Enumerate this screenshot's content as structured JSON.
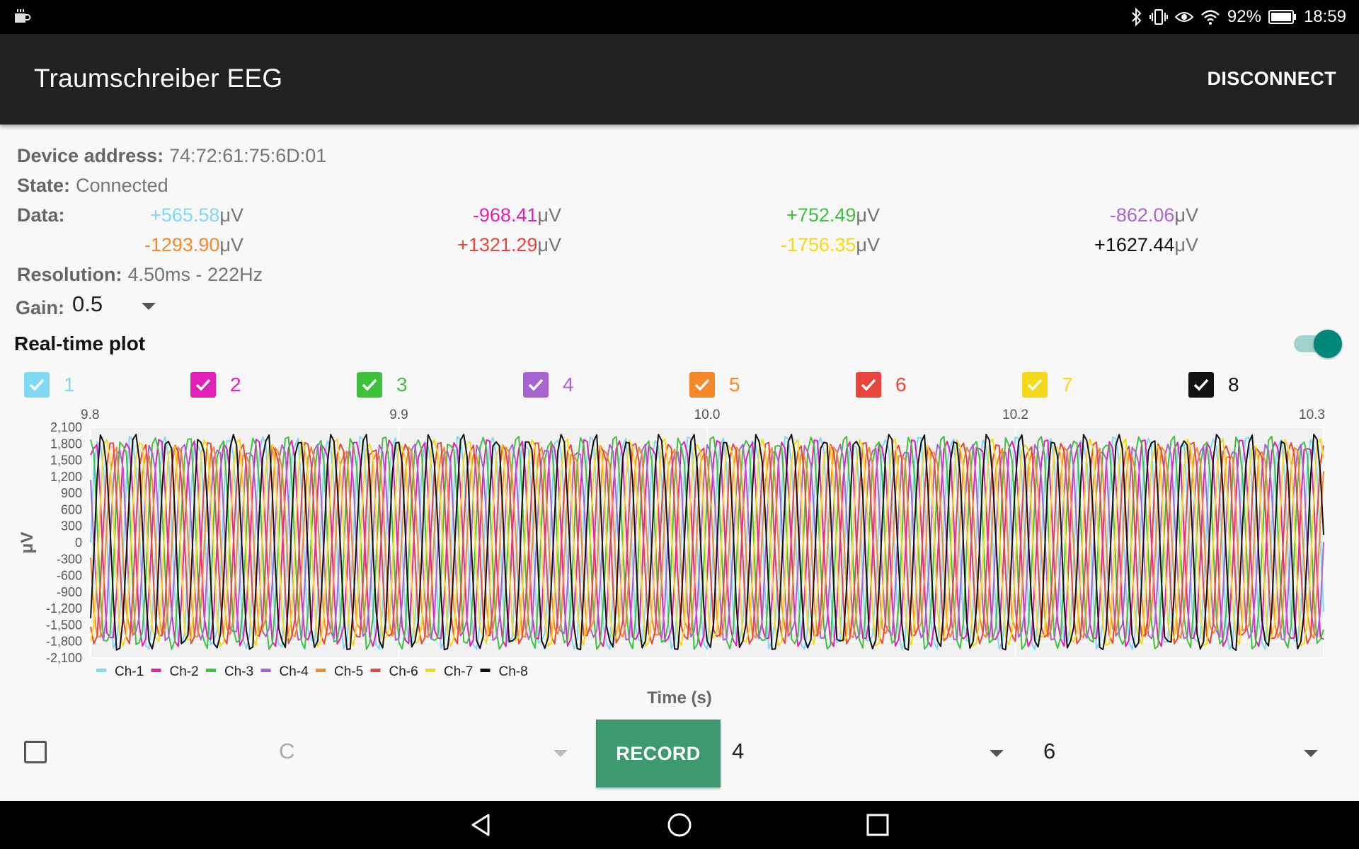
{
  "status_bar": {
    "battery": "92%",
    "time": "18:59",
    "icons": [
      "coffee-icon",
      "bluetooth-icon",
      "vibrate-icon",
      "eye-icon",
      "wifi-icon",
      "battery-icon"
    ]
  },
  "app_bar": {
    "title": "Traumschreiber EEG",
    "action": "DISCONNECT"
  },
  "info": {
    "device_label": "Device address:",
    "device_value": "74:72:61:75:6D:01",
    "state_label": "State:",
    "state_value": "Connected",
    "data_label": "Data:",
    "resolution_label": "Resolution:",
    "resolution_value": "4.50ms - 222Hz",
    "gain_label": "Gain:",
    "gain_value": "0.5"
  },
  "data_unit": "μV",
  "data_values": [
    {
      "value": "+565.58",
      "color": "#7fd8f5"
    },
    {
      "value": "-968.41",
      "color": "#e020b8"
    },
    {
      "value": "+752.49",
      "color": "#3ec23e"
    },
    {
      "value": "-862.06",
      "color": "#a864d2"
    },
    {
      "value": "-1293.90",
      "color": "#f5892a"
    },
    {
      "value": "+1321.29",
      "color": "#e8453c"
    },
    {
      "value": "-1756.35",
      "color": "#f6d81a"
    },
    {
      "value": "+1627.44",
      "color": "#111111"
    }
  ],
  "realtime_plot": {
    "title": "Real-time plot",
    "enabled": true
  },
  "channels": [
    {
      "label": "1",
      "color": "#7fd8f5",
      "checked": true
    },
    {
      "label": "2",
      "color": "#e020b8",
      "checked": true
    },
    {
      "label": "3",
      "color": "#3ec23e",
      "checked": true
    },
    {
      "label": "4",
      "color": "#a864d2",
      "checked": true
    },
    {
      "label": "5",
      "color": "#f5892a",
      "checked": true
    },
    {
      "label": "6",
      "color": "#e8453c",
      "checked": true
    },
    {
      "label": "7",
      "color": "#f6d81a",
      "checked": true
    },
    {
      "label": "8",
      "color": "#111111",
      "checked": true
    }
  ],
  "chart_data": {
    "type": "line",
    "xlabel": "Time (s)",
    "ylabel": "μV",
    "x_ticks": [
      "9.8",
      "9.9",
      "10.0",
      "10.2",
      "10.3"
    ],
    "x_tick_values": [
      9.8,
      9.9,
      10.0,
      10.1,
      10.2
    ],
    "xlim": [
      9.8,
      10.2
    ],
    "ylim": [
      -2100,
      2100
    ],
    "y_ticks": [
      "2,100",
      "1,800",
      "1,500",
      "1,200",
      "900",
      "600",
      "300",
      "0",
      "-300",
      "-600",
      "-900",
      "-1,200",
      "-1,500",
      "-1,800",
      "-2,100"
    ],
    "grid": true,
    "legend_position": "bottom-left",
    "series": [
      {
        "name": "Ch-1",
        "color": "#7fd8f5",
        "amplitude": 1850,
        "cycles_per_second": 100,
        "phase": 0.0
      },
      {
        "name": "Ch-2",
        "color": "#e020b8",
        "amplitude": 1800,
        "cycles_per_second": 100,
        "phase": 0.9
      },
      {
        "name": "Ch-3",
        "color": "#3ec23e",
        "amplitude": 1850,
        "cycles_per_second": 100,
        "phase": 1.7
      },
      {
        "name": "Ch-4",
        "color": "#a864d2",
        "amplitude": 1700,
        "cycles_per_second": 100,
        "phase": 2.5
      },
      {
        "name": "Ch-5",
        "color": "#f5892a",
        "amplitude": 1650,
        "cycles_per_second": 100,
        "phase": 3.3
      },
      {
        "name": "Ch-6",
        "color": "#e8453c",
        "amplitude": 1750,
        "cycles_per_second": 100,
        "phase": 4.0
      },
      {
        "name": "Ch-7",
        "color": "#f6d81a",
        "amplitude": 1800,
        "cycles_per_second": 100,
        "phase": 4.8
      },
      {
        "name": "Ch-8",
        "color": "#111111",
        "amplitude": 1880,
        "cycles_per_second": 100,
        "phase": 5.6
      }
    ]
  },
  "bottom": {
    "spinner1": "C",
    "record_label": "RECORD",
    "spinner2": "4",
    "spinner3": "6"
  }
}
